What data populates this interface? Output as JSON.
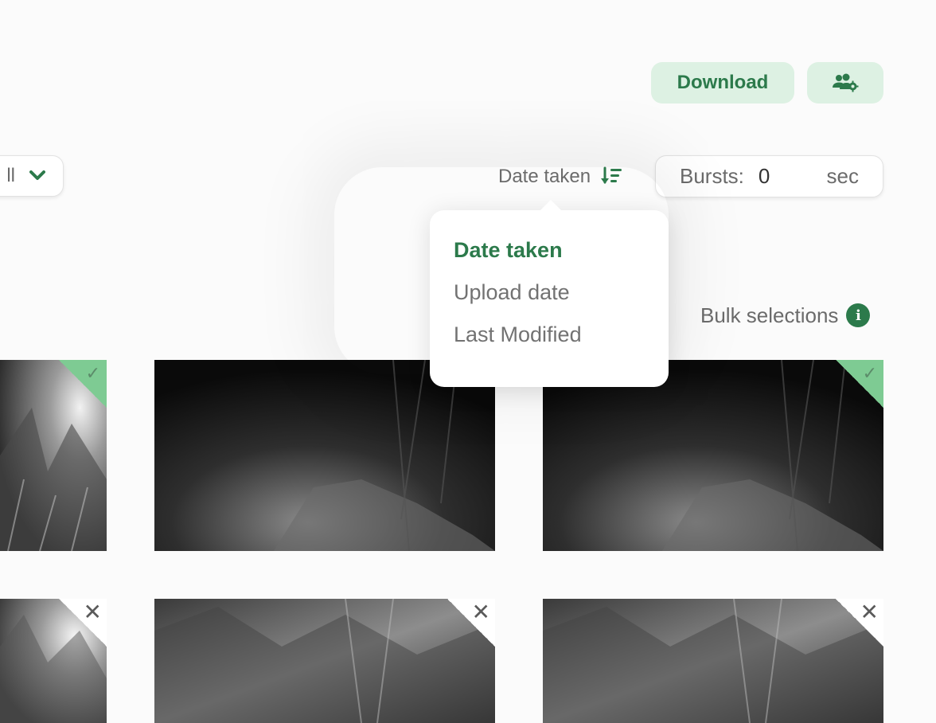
{
  "header": {
    "download_label": "Download",
    "team_icon": "users-gear-icon"
  },
  "filter": {
    "value": "ll",
    "chevron_icon": "chevron-down-icon"
  },
  "sort": {
    "current_label": "Date taken",
    "icon": "sort-descending-icon",
    "options": [
      {
        "label": "Date taken",
        "active": true
      },
      {
        "label": "Upload date",
        "active": false
      },
      {
        "label": "Last Modified",
        "active": false
      }
    ]
  },
  "bursts": {
    "label": "Bursts:",
    "value": "0",
    "unit": "sec"
  },
  "bulk": {
    "label": "Bulk selections",
    "icon": "info-icon"
  },
  "thumbnails": [
    {
      "status": "selected",
      "icon": "check-icon"
    },
    {
      "status": "none",
      "icon": ""
    },
    {
      "status": "selected",
      "icon": "check-icon"
    },
    {
      "status": "excluded",
      "icon": "close-icon"
    },
    {
      "status": "excluded",
      "icon": "close-icon"
    },
    {
      "status": "excluded",
      "icon": "close-icon"
    }
  ],
  "colors": {
    "accent": "#2c7a4b",
    "accent_light": "#ddf1e3",
    "selected_corner": "#7ecb93"
  }
}
